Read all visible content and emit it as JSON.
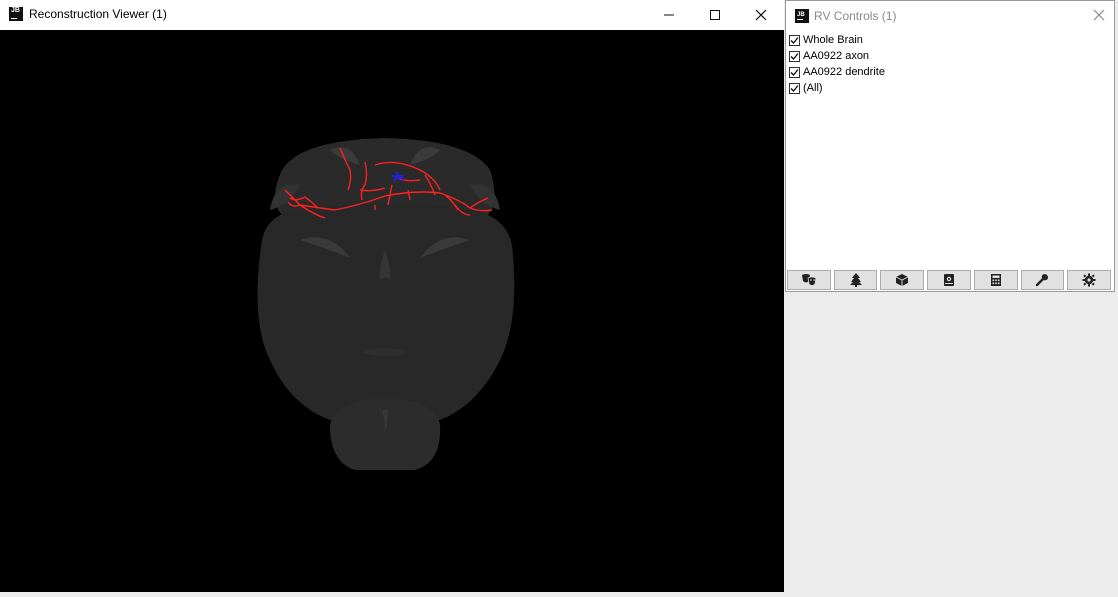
{
  "main_window": {
    "title": "Reconstruction Viewer (1)",
    "background_color": "#000000",
    "buttons": [
      "minimize-icon",
      "maximize-icon",
      "close-icon"
    ]
  },
  "scene": {
    "brain_color": "#2b2b2b",
    "axon_color": "#ff2020",
    "dendrite_color": "#2020ff"
  },
  "controls": {
    "title": "RV Controls (1)",
    "items": [
      {
        "label": "Whole Brain",
        "checked": true
      },
      {
        "label": "AA0922 axon",
        "checked": true
      },
      {
        "label": "AA0922 dendrite",
        "checked": true
      },
      {
        "label": "(All)",
        "checked": true
      }
    ],
    "toolbar": [
      "masks-icon",
      "tree-icon",
      "cube-icon",
      "book-icon",
      "calculator-icon",
      "wrench-icon",
      "gear-icon"
    ]
  }
}
